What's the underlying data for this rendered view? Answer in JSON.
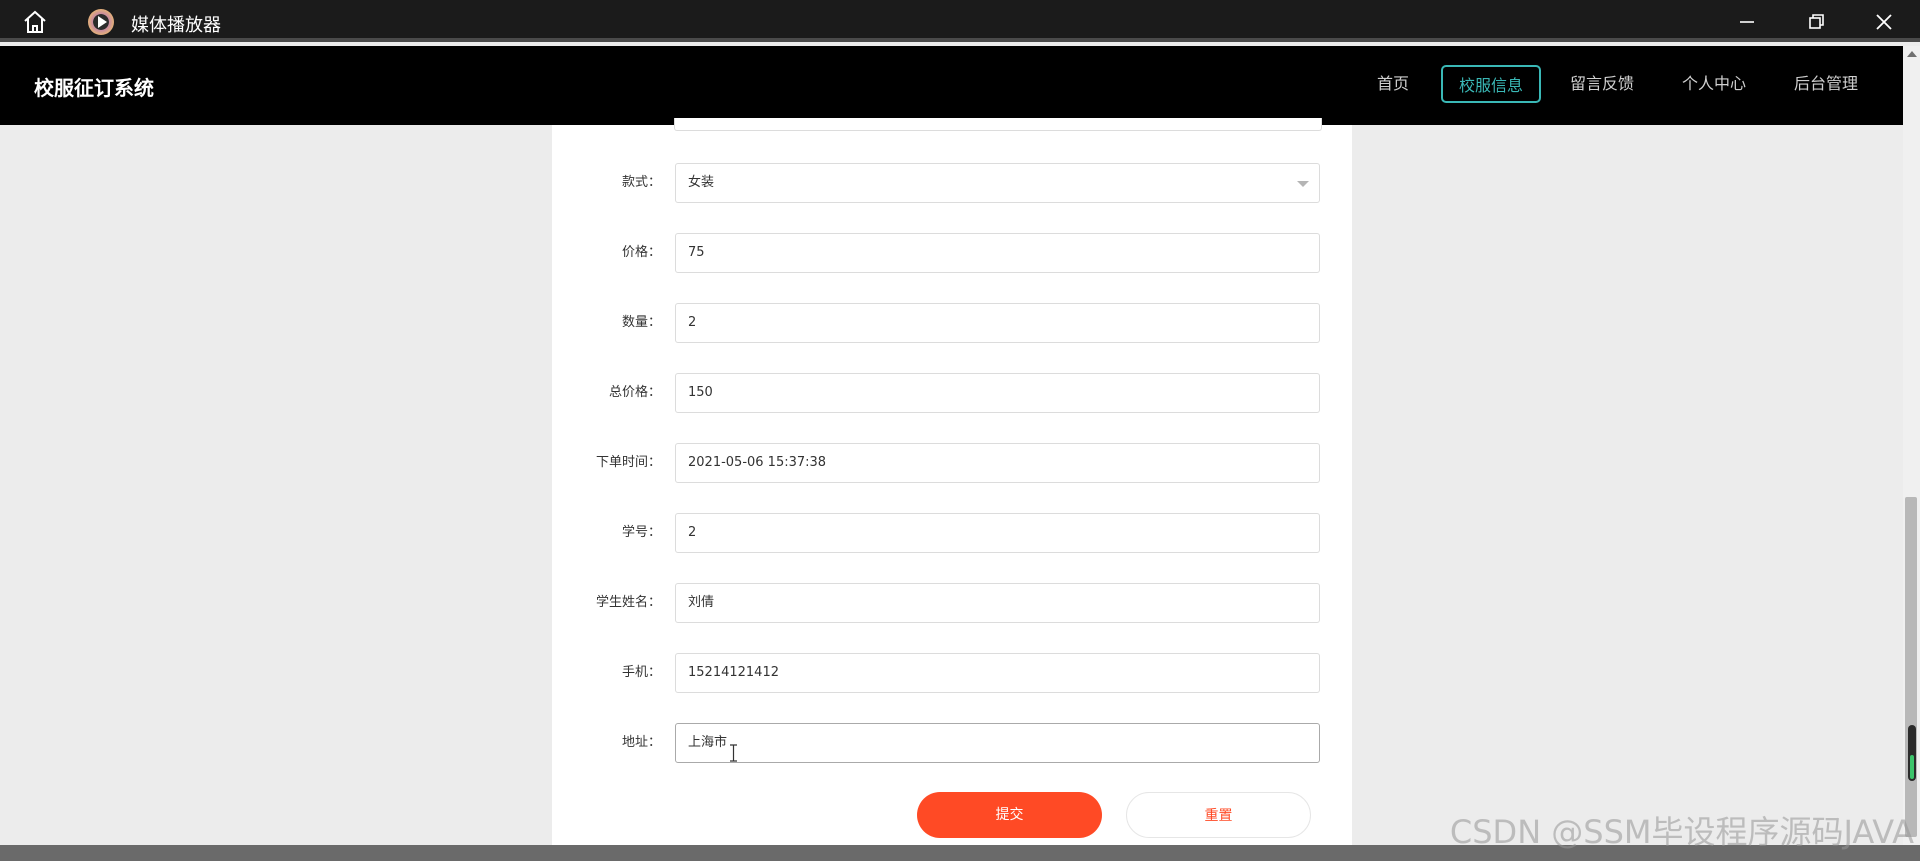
{
  "player": {
    "title": "媒体播放器",
    "icons": {
      "home": "home-icon",
      "logo": "play-logo-icon",
      "minimize": "minimize-icon",
      "maximize": "restore-icon",
      "close": "close-icon"
    }
  },
  "site": {
    "title": "校服征订系统",
    "nav": [
      {
        "label": "首页",
        "active": false
      },
      {
        "label": "校服信息",
        "active": true
      },
      {
        "label": "留言反馈",
        "active": false
      },
      {
        "label": "个人中心",
        "active": false
      },
      {
        "label": "后台管理",
        "active": false
      }
    ],
    "accent_color": "#3ab8b6"
  },
  "form": {
    "fields": [
      {
        "label": "款式：",
        "value": "女装",
        "type": "select"
      },
      {
        "label": "价格：",
        "value": "75",
        "type": "text"
      },
      {
        "label": "数量：",
        "value": "2",
        "type": "text"
      },
      {
        "label": "总价格：",
        "value": "150",
        "type": "text"
      },
      {
        "label": "下单时间：",
        "value": "2021-05-06 15:37:38",
        "type": "text"
      },
      {
        "label": "学号：",
        "value": "2",
        "type": "text"
      },
      {
        "label": "学生姓名：",
        "value": "刘倩",
        "type": "text"
      },
      {
        "label": "手机：",
        "value": "15214121412",
        "type": "text"
      },
      {
        "label": "地址：",
        "value": "上海市",
        "type": "text"
      }
    ],
    "submit_label": "提交",
    "reset_label": "重置",
    "button_color": "#ff4a25"
  },
  "watermark": "CSDN @SSM毕设程序源码JAVA"
}
